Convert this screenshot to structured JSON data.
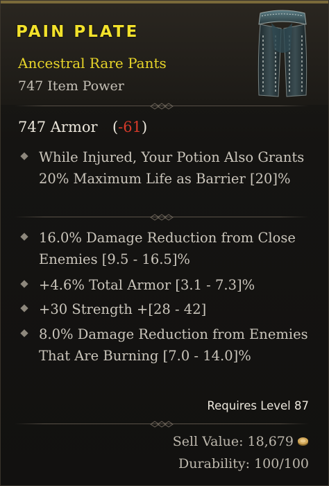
{
  "item": {
    "name": "PAIN PLATE",
    "type": "Ancestral Rare Pants",
    "power": "747 Item Power",
    "image_icon": "plate-pants-icon"
  },
  "armor": {
    "value": "747 Armor",
    "open_paren": "(",
    "delta": "-61",
    "close_paren": ")"
  },
  "implicit_affixes": [
    {
      "text": "While Injured, Your Potion Also Grants 20% Maximum Life as Barrier [20]%"
    }
  ],
  "affixes": [
    {
      "text": "16.0% Damage Reduction from Close Enemies [9.5 - 16.5]%"
    },
    {
      "text": "+4.6% Total Armor [3.1 - 7.3]%"
    },
    {
      "text": "+30 Strength +[28 - 42]"
    },
    {
      "text": "8.0% Damage Reduction from Enemies That Are Burning [7.0 - 14.0]%"
    }
  ],
  "requirements": {
    "level_text": "Requires Level 87"
  },
  "footer": {
    "sell_label": "Sell Value: 18,679",
    "coin_icon": "gold-coin-icon",
    "durability_label": "Durability: 100/100"
  },
  "colors": {
    "rare_yellow": "#f2e12b",
    "negative_red": "#d83a2a",
    "text": "#cbc6bc"
  }
}
